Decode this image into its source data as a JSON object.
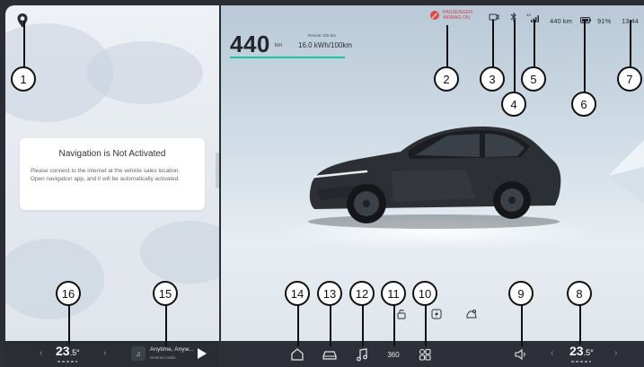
{
  "navigation": {
    "card_title": "Navigation is Not Activated",
    "card_message": "Please connect to the internet at the vehicle sales location. Open navigation app, and it will be automatically activated."
  },
  "vehicle": {
    "range_value": "440",
    "range_unit": "km",
    "recent_label": "Recent 100 km",
    "consumption": "16.0 kWh/100km",
    "range_fill_fraction": 1.0
  },
  "status_bar": {
    "airbag_line1": "PASSENGER",
    "airbag_line2": "AIRBAG ON",
    "range_text": "440 km",
    "battery_percent": "91%",
    "clock": "13:44",
    "signal_label": "4G"
  },
  "climate": {
    "driver_temp": "23",
    "driver_temp_decimal": ".5°",
    "passenger_temp": "23",
    "passenger_temp_decimal": ".5°"
  },
  "media": {
    "title": "Anytime, Anyw...",
    "subtitle": "Desired Audio"
  },
  "dock": {
    "label_360": "360"
  },
  "callouts": [
    "1",
    "2",
    "3",
    "4",
    "5",
    "6",
    "7",
    "8",
    "9",
    "10",
    "11",
    "12",
    "13",
    "14",
    "15",
    "16"
  ],
  "colors": {
    "accent": "#19c7a8",
    "airbag_warning": "#e0484a",
    "dock_background": "#2d3038"
  },
  "icons": {
    "nav": "location-pin-icon",
    "airbag": "airbag-off-icon",
    "dashcam": "dashcam-icon",
    "bluetooth": "bluetooth-icon",
    "cellular": "cellular-signal-icon",
    "battery": "battery-icon",
    "home": "home-icon",
    "vehicle": "vehicle-icon",
    "music": "music-icon",
    "camera360": "camera-360-icon",
    "apps": "apps-grid-icon",
    "volume": "volume-icon",
    "unlock": "unlock-icon",
    "charge": "charge-port-icon",
    "trunk": "trunk-icon"
  }
}
